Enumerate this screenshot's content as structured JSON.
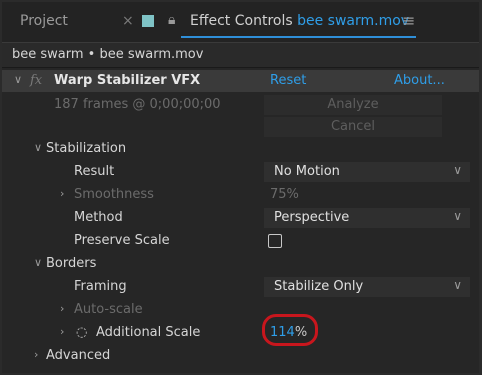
{
  "tabs": {
    "project": "Project",
    "close": "×",
    "effect_controls_prefix": "Effect Controls",
    "effect_controls_file": "bee swarm.mov",
    "menu": "≡"
  },
  "breadcrumb": "bee swarm • bee swarm.mov",
  "effect": {
    "name": "Warp Stabilizer VFX",
    "reset": "Reset",
    "about": "About...",
    "fx": "fx",
    "frames_info": "187 frames @ 0;00;00;00",
    "analyze": "Analyze",
    "cancel": "Cancel"
  },
  "stabilization": {
    "section": "Stabilization",
    "result_label": "Result",
    "result_value": "No Motion",
    "smoothness_label": "Smoothness",
    "smoothness_value": "75%",
    "method_label": "Method",
    "method_value": "Perspective",
    "preserve_label": "Preserve Scale"
  },
  "borders": {
    "section": "Borders",
    "framing_label": "Framing",
    "framing_value": "Stabilize Only",
    "autoscale_label": "Auto-scale",
    "additional_scale_label": "Additional Scale",
    "additional_scale_number": "114",
    "additional_scale_unit": "%"
  },
  "advanced": "Advanced",
  "colors": {
    "accent": "#2f9ee8",
    "highlight": "#c8161d",
    "swatch": "#7fc3c6"
  }
}
